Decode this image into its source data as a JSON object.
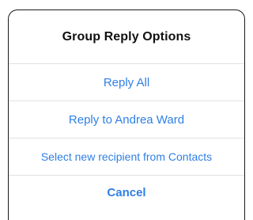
{
  "sheet": {
    "title": "Group Reply Options",
    "options": [
      {
        "label": "Reply All"
      },
      {
        "label": "Reply to Andrea Ward"
      },
      {
        "label": "Select new recipient from Contacts"
      }
    ],
    "cancel_label": "Cancel"
  },
  "colors": {
    "accent": "#2f7fe6",
    "title_text": "#111111",
    "divider": "#e1e1e3",
    "border": "#1a1a1a",
    "background": "#ffffff"
  }
}
